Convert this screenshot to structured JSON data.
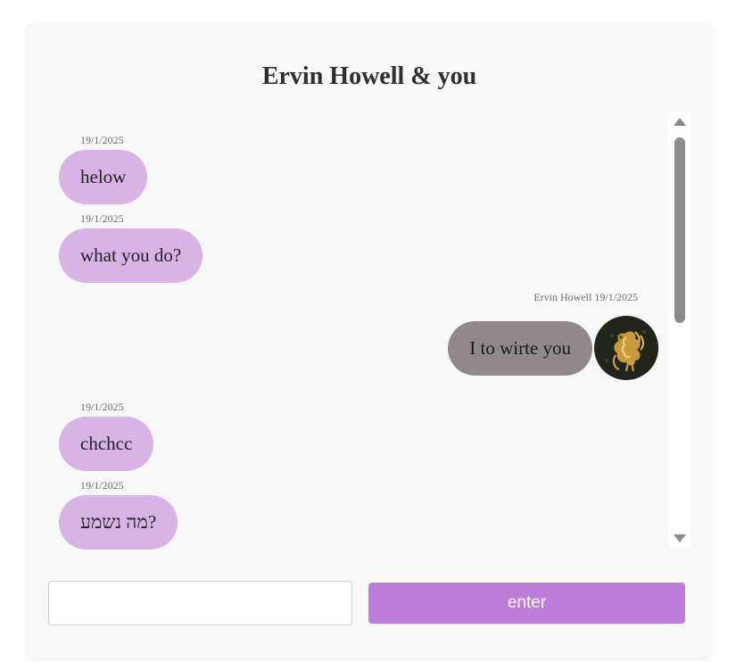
{
  "chat": {
    "title": "Ervin Howell & you"
  },
  "messages": [
    {
      "side": "left",
      "stamp": "19/1/2025",
      "text": "helow"
    },
    {
      "side": "left",
      "stamp": "19/1/2025",
      "text": "what you do?"
    },
    {
      "side": "right",
      "stamp": "Ervin Howell 19/1/2025",
      "text": "I to wirte you",
      "avatar_icon": "golden-phoenix-avatar"
    },
    {
      "side": "left",
      "stamp": "19/1/2025",
      "text": "chchcc"
    },
    {
      "side": "left",
      "stamp": "19/1/2025",
      "text": "מה נשמע?"
    }
  ],
  "composer": {
    "input_value": "",
    "input_placeholder": "",
    "send_label": "enter"
  },
  "colors": {
    "my_bubble": "#d8b3e5",
    "their_bubble": "#8f898c",
    "send_button": "#bb7dd8",
    "background": "#f8f8f9"
  }
}
